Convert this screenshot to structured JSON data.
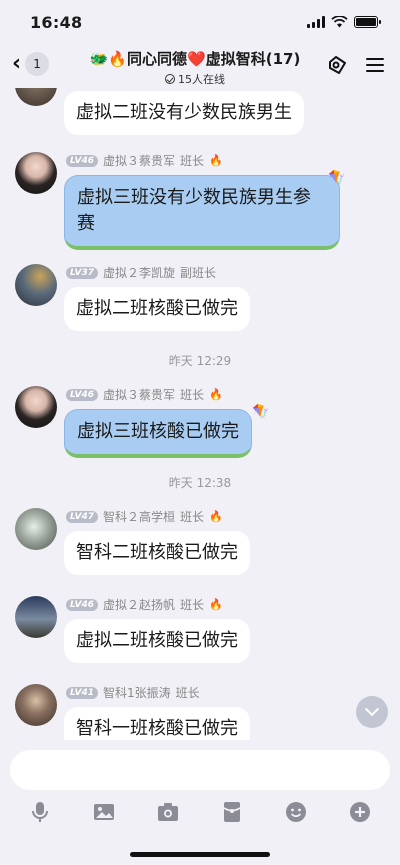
{
  "status": {
    "time": "16:48"
  },
  "header": {
    "back_count": "1",
    "title": "同心同德❤️虚拟智科(17)",
    "online": "15人在线"
  },
  "messages": [
    {
      "id": "m0",
      "text": "虚拟二班没有少数民族男生",
      "style": "white"
    },
    {
      "id": "m1",
      "level": "LV46",
      "name": "虚拟３蔡贵军",
      "role": "班长",
      "fire": true,
      "text": "虚拟三班没有少数民族男生参赛",
      "style": "blue"
    },
    {
      "id": "m2",
      "level": "LV37",
      "name": "虚拟２李凯旋",
      "role": "副班长",
      "fire": false,
      "text": "虚拟二班核酸已做完",
      "style": "white"
    },
    {
      "id": "m3",
      "level": "LV46",
      "name": "虚拟３蔡贵军",
      "role": "班长",
      "fire": true,
      "text": "虚拟三班核酸已做完",
      "style": "blue"
    },
    {
      "id": "m4",
      "level": "LV47",
      "name": "智科２高学桓",
      "role": "班长",
      "fire": true,
      "text": "智科二班核酸已做完",
      "style": "white"
    },
    {
      "id": "m5",
      "level": "LV46",
      "name": "虚拟２赵扬帆",
      "role": "班长",
      "fire": true,
      "text": "虚拟二班核酸已做完",
      "style": "white"
    },
    {
      "id": "m6",
      "level": "LV41",
      "name": "智科1张振涛",
      "role": "班长",
      "fire": false,
      "text": "智科一班核酸已做完",
      "style": "white"
    }
  ],
  "time_separators": [
    "昨天 12:29",
    "昨天 12:38"
  ],
  "input": {
    "placeholder": ""
  },
  "toolbar": [
    "microphone-icon",
    "image-icon",
    "camera-icon",
    "red-packet-icon",
    "emoji-icon",
    "plus-icon"
  ],
  "colors": {
    "background": "#f0f0f6",
    "blue_bubble": "#a9cdf2",
    "level_badge": "#b8bcc8"
  }
}
